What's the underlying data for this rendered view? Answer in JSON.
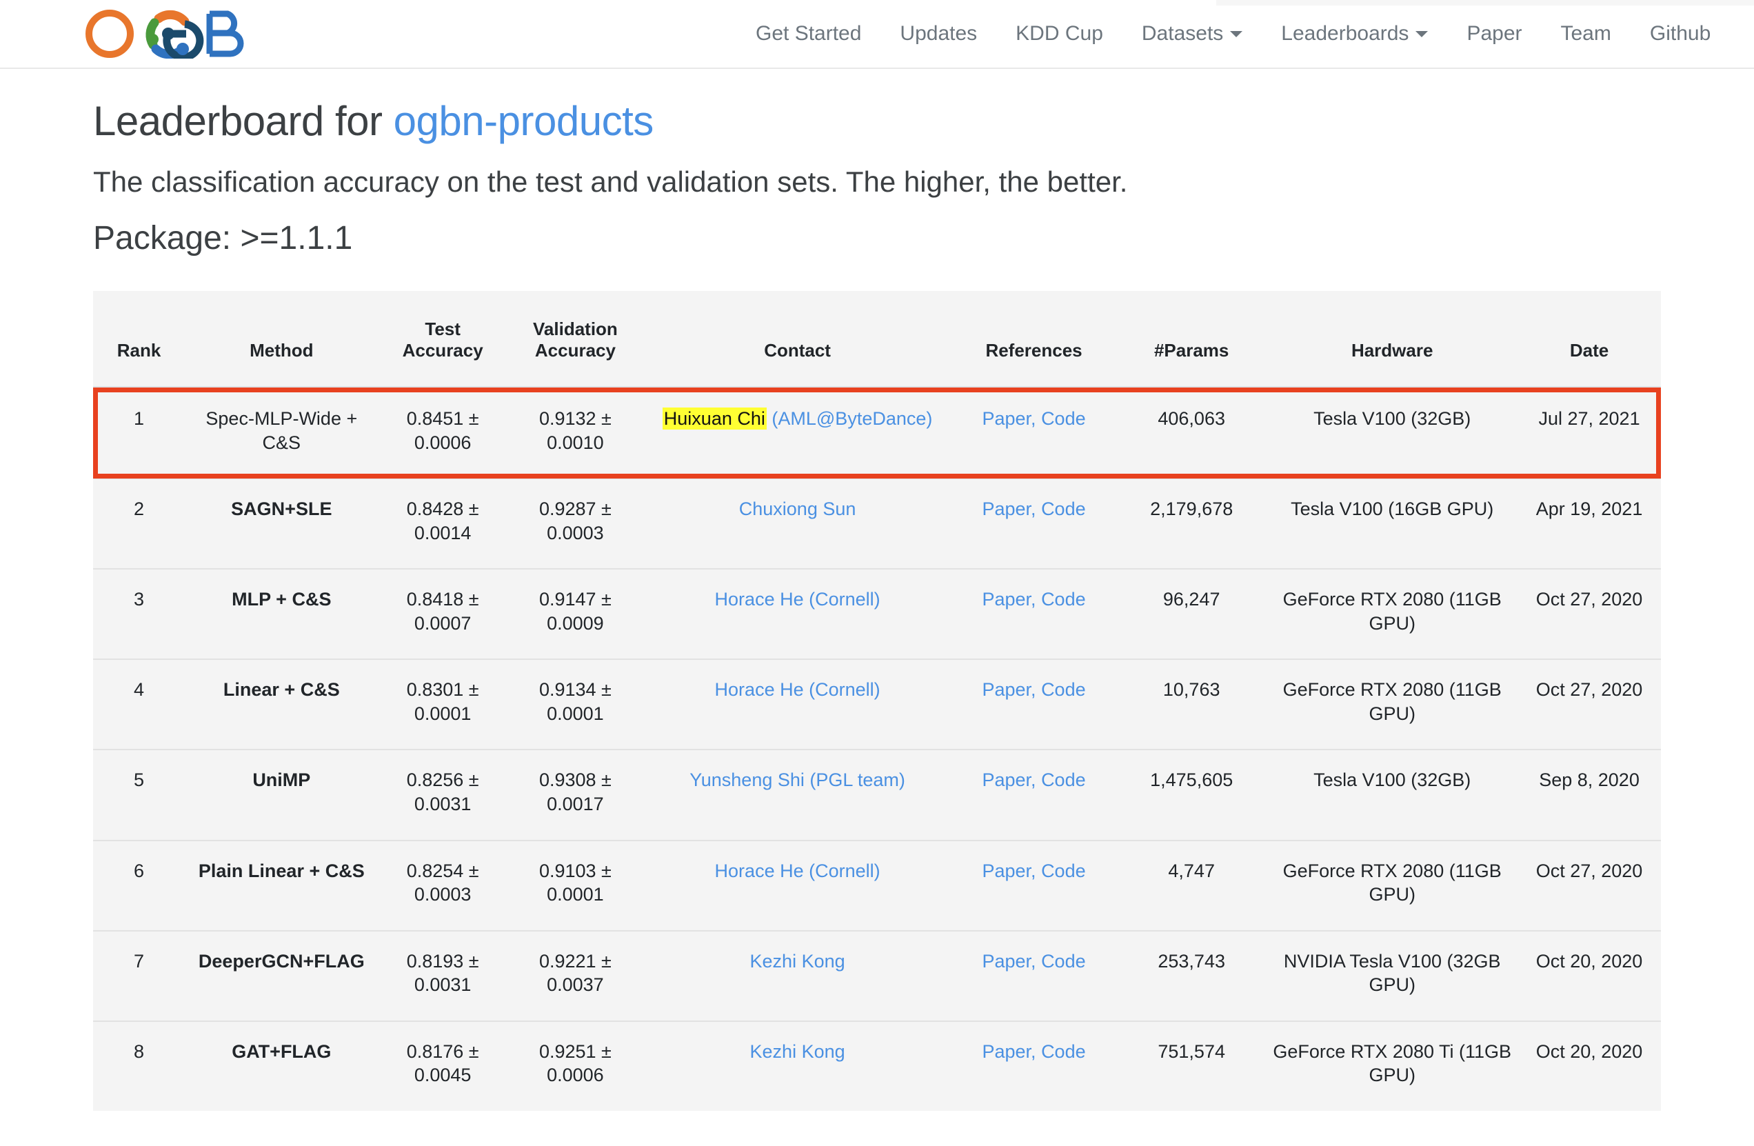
{
  "nav": {
    "logo_alt": "OGB logo",
    "links": [
      {
        "label": "Get Started",
        "has_caret": false
      },
      {
        "label": "Updates",
        "has_caret": false
      },
      {
        "label": "KDD Cup",
        "has_caret": false
      },
      {
        "label": "Datasets",
        "has_caret": true
      },
      {
        "label": "Leaderboards",
        "has_caret": true
      },
      {
        "label": "Paper",
        "has_caret": false
      },
      {
        "label": "Team",
        "has_caret": false
      },
      {
        "label": "Github",
        "has_caret": false
      }
    ]
  },
  "heading": {
    "title_prefix": "Leaderboard for ",
    "dataset": "ogbn-products",
    "subtitle": "The classification accuracy on the test and validation sets. The higher, the better.",
    "package": "Package: >=1.1.1"
  },
  "colors": {
    "link": "#4a90e2",
    "highlight_border": "#e8411f",
    "text_highlight": "#ffff33",
    "table_bg": "#f4f4f4",
    "header_rule": "#dee2e6"
  },
  "table": {
    "headers": {
      "rank": "Rank",
      "method": "Method",
      "test_accuracy_line1": "Test",
      "test_accuracy_line2": "Accuracy",
      "validation_accuracy_line1": "Validation",
      "validation_accuracy_line2": "Accuracy",
      "contact": "Contact",
      "references": "References",
      "params": "#Params",
      "hardware": "Hardware",
      "date": "Date"
    },
    "reference_labels": {
      "paper": "Paper,",
      "code": "Code"
    },
    "rows": [
      {
        "rank": "1",
        "method": "Spec-MLP-Wide + C&S",
        "method_bold": false,
        "test_accuracy": "0.8451 ± 0.0006",
        "validation_accuracy": "0.9132 ± 0.0010",
        "contact_name": "Huixuan Chi",
        "contact_name_highlighted": true,
        "contact_affiliation": "(AML@ByteDance)",
        "params": "406,063",
        "hardware": "Tesla V100 (32GB)",
        "date": "Jul 27, 2021",
        "row_highlighted": true
      },
      {
        "rank": "2",
        "method": "SAGN+SLE",
        "method_bold": true,
        "test_accuracy": "0.8428 ± 0.0014",
        "validation_accuracy": "0.9287 ± 0.0003",
        "contact_name": "Chuxiong Sun",
        "contact_name_highlighted": false,
        "contact_affiliation": "",
        "params": "2,179,678",
        "hardware": "Tesla V100 (16GB GPU)",
        "date": "Apr 19, 2021",
        "row_highlighted": false
      },
      {
        "rank": "3",
        "method": "MLP + C&S",
        "method_bold": true,
        "test_accuracy": "0.8418 ± 0.0007",
        "validation_accuracy": "0.9147 ± 0.0009",
        "contact_name": "Horace He (Cornell)",
        "contact_name_highlighted": false,
        "contact_affiliation": "",
        "params": "96,247",
        "hardware": "GeForce RTX 2080 (11GB GPU)",
        "date": "Oct 27, 2020",
        "row_highlighted": false
      },
      {
        "rank": "4",
        "method": "Linear + C&S",
        "method_bold": true,
        "test_accuracy": "0.8301 ± 0.0001",
        "validation_accuracy": "0.9134 ± 0.0001",
        "contact_name": "Horace He (Cornell)",
        "contact_name_highlighted": false,
        "contact_affiliation": "",
        "params": "10,763",
        "hardware": "GeForce RTX 2080 (11GB GPU)",
        "date": "Oct 27, 2020",
        "row_highlighted": false
      },
      {
        "rank": "5",
        "method": "UniMP",
        "method_bold": true,
        "test_accuracy": "0.8256 ± 0.0031",
        "validation_accuracy": "0.9308 ± 0.0017",
        "contact_name": "Yunsheng Shi (PGL team)",
        "contact_name_highlighted": false,
        "contact_affiliation": "",
        "params": "1,475,605",
        "hardware": "Tesla V100 (32GB)",
        "date": "Sep 8, 2020",
        "row_highlighted": false
      },
      {
        "rank": "6",
        "method": "Plain Linear + C&S",
        "method_bold": true,
        "test_accuracy": "0.8254 ± 0.0003",
        "validation_accuracy": "0.9103 ± 0.0001",
        "contact_name": "Horace He (Cornell)",
        "contact_name_highlighted": false,
        "contact_affiliation": "",
        "params": "4,747",
        "hardware": "GeForce RTX 2080 (11GB GPU)",
        "date": "Oct 27, 2020",
        "row_highlighted": false
      },
      {
        "rank": "7",
        "method": "DeeperGCN+FLAG",
        "method_bold": true,
        "test_accuracy": "0.8193 ± 0.0031",
        "validation_accuracy": "0.9221 ± 0.0037",
        "contact_name": "Kezhi Kong",
        "contact_name_highlighted": false,
        "contact_affiliation": "",
        "params": "253,743",
        "hardware": "NVIDIA Tesla V100 (32GB GPU)",
        "date": "Oct 20, 2020",
        "row_highlighted": false
      },
      {
        "rank": "8",
        "method": "GAT+FLAG",
        "method_bold": true,
        "test_accuracy": "0.8176 ± 0.0045",
        "validation_accuracy": "0.9251 ± 0.0006",
        "contact_name": "Kezhi Kong",
        "contact_name_highlighted": false,
        "contact_affiliation": "",
        "params": "751,574",
        "hardware": "GeForce RTX 2080 Ti (11GB GPU)",
        "date": "Oct 20, 2020",
        "row_highlighted": false
      }
    ]
  }
}
